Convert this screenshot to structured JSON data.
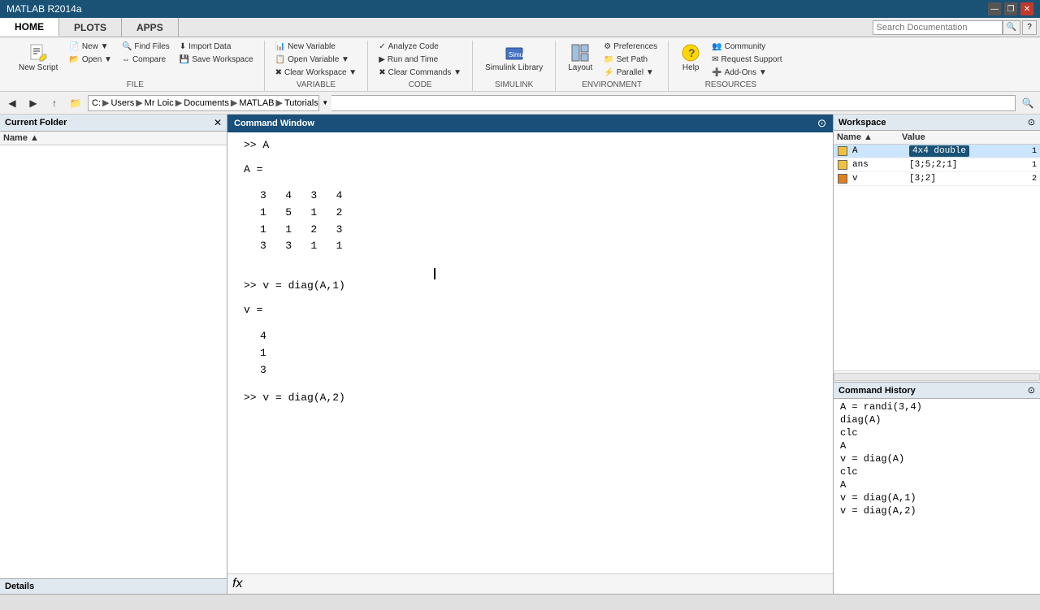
{
  "titlebar": {
    "title": "MATLAB R2014a",
    "minimize": "—",
    "maximize": "❐",
    "close": "✕"
  },
  "tabs": [
    {
      "id": "home",
      "label": "HOME",
      "active": true
    },
    {
      "id": "plots",
      "label": "PLOTS",
      "active": false
    },
    {
      "id": "apps",
      "label": "APPS",
      "active": false
    }
  ],
  "ribbon": {
    "sections": {
      "file": {
        "label": "FILE",
        "buttons": [
          "New Script",
          "New",
          "Open",
          "Find Files",
          "Compare",
          "Import Data",
          "Save Workspace"
        ]
      },
      "variable": {
        "label": "VARIABLE",
        "buttons": [
          "New Variable",
          "Open Variable",
          "Clear Workspace"
        ]
      },
      "code": {
        "label": "CODE",
        "buttons": [
          "Analyze Code",
          "Run and Time",
          "Clear Commands"
        ]
      },
      "simulink": {
        "label": "SIMULINK",
        "buttons": [
          "Simulink Library"
        ]
      },
      "environment": {
        "label": "ENVIRONMENT",
        "buttons": [
          "Layout",
          "Preferences",
          "Set Path",
          "Parallel"
        ]
      },
      "resources": {
        "label": "RESOURCES",
        "buttons": [
          "Help",
          "Community",
          "Request Support",
          "Add-Ons"
        ]
      }
    }
  },
  "toolbar": {
    "back": "◀",
    "forward": "▶",
    "up": "↑",
    "address": [
      "C:",
      "Users",
      "Mr Loic",
      "Documents",
      "MATLAB",
      "Tutorials"
    ]
  },
  "folder_panel": {
    "title": "Current Folder",
    "col_name": "Name ▲",
    "details": "Details"
  },
  "cmd_window": {
    "title": "Command Window",
    "lines": [
      ">> A",
      "",
      "A =",
      "",
      "   3   4   3   4",
      "   1   5   1   2",
      "   1   1   2   3",
      "   3   3   1   1",
      "",
      ">> v = diag(A,1)",
      "",
      "v =",
      "",
      "   4",
      "   1",
      "   3",
      "",
      ">> v = diag(A,2)",
      ""
    ],
    "footer": "fx"
  },
  "workspace": {
    "title": "Workspace",
    "col_name": "Name ▲",
    "col_value": "Value",
    "col_extra": "",
    "rows": [
      {
        "name": "A",
        "value": "4x4 double",
        "extra": "1",
        "selected": true,
        "color": "yellow"
      },
      {
        "name": "ans",
        "value": "[3;5;2;1]",
        "extra": "1",
        "selected": false,
        "color": "yellow"
      },
      {
        "name": "v",
        "value": "[3;2]",
        "extra": "2",
        "selected": false,
        "color": "orange"
      }
    ]
  },
  "cmd_history": {
    "title": "Command History",
    "items": [
      "A = randi(3,4)",
      "diag(A)",
      "clc",
      "A",
      "v = diag(A)",
      "clc",
      "A",
      "v = diag(A,1)",
      "v = diag(A,2)"
    ]
  },
  "statusbar": {
    "text": ""
  }
}
